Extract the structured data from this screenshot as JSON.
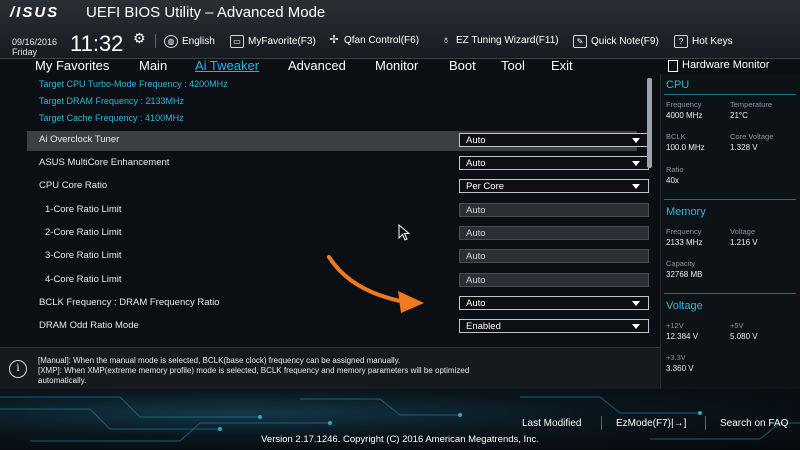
{
  "header": {
    "brand": "/ISUS",
    "title": "UEFI BIOS Utility – Advanced Mode",
    "date": "09/16/2016",
    "day": "Friday",
    "time": "11:32",
    "tools": [
      {
        "label": "English",
        "icon": "globe-icon"
      },
      {
        "label": "MyFavorite(F3)",
        "icon": "favorite-icon"
      },
      {
        "label": "Qfan Control(F6)",
        "icon": "fan-icon"
      },
      {
        "label": "EZ Tuning Wizard(F11)",
        "icon": "bulb-icon"
      },
      {
        "label": "Quick Note(F9)",
        "icon": "note-icon"
      },
      {
        "label": "Hot Keys",
        "icon": "help-icon"
      }
    ]
  },
  "menu": {
    "items": [
      "My Favorites",
      "Main",
      "Ai Tweaker",
      "Advanced",
      "Monitor",
      "Boot",
      "Tool",
      "Exit"
    ],
    "active": "Ai Tweaker"
  },
  "info": [
    "Target CPU Turbo-Mode Frequency : 4200MHz",
    "Target DRAM Frequency : 2133MHz",
    "Target Cache Frequency : 4100MHz"
  ],
  "settings": [
    {
      "label": "Ai Overclock Tuner",
      "value": "Auto",
      "type": "dropdown",
      "selected": true
    },
    {
      "label": "ASUS MultiCore Enhancement",
      "value": "Auto",
      "type": "dropdown"
    },
    {
      "label": "CPU Core Ratio",
      "value": "Per Core",
      "type": "dropdown"
    },
    {
      "label": "1-Core Ratio Limit",
      "value": "Auto",
      "type": "textbox",
      "sub": true
    },
    {
      "label": "2-Core Ratio Limit",
      "value": "Auto",
      "type": "textbox",
      "sub": true
    },
    {
      "label": "3-Core Ratio Limit",
      "value": "Auto",
      "type": "textbox",
      "sub": true
    },
    {
      "label": "4-Core Ratio Limit",
      "value": "Auto",
      "type": "textbox",
      "sub": true
    },
    {
      "label": "BCLK Frequency : DRAM Frequency Ratio",
      "value": "Auto",
      "type": "dropdown"
    },
    {
      "label": "DRAM Odd Ratio Mode",
      "value": "Enabled",
      "type": "dropdown"
    }
  ],
  "help": {
    "lines": [
      "[Manual]: When the manual mode is selected, BCLK(base clock) frequency can be assigned manually.",
      "[XMP]: When XMP(extreme memory profile) mode is selected, BCLK frequency and memory parameters will be optimized",
      "automatically."
    ]
  },
  "hardware_monitor": {
    "title": "Hardware Monitor",
    "cpu": {
      "heading": "CPU",
      "frequency_label": "Frequency",
      "frequency": "4000 MHz",
      "temperature_label": "Temperature",
      "temperature": "21°C",
      "bclk_label": "BCLK",
      "bclk": "100.0 MHz",
      "core_voltage_label": "Core Voltage",
      "core_voltage": "1.328 V",
      "ratio_label": "Ratio",
      "ratio": "40x"
    },
    "memory": {
      "heading": "Memory",
      "frequency_label": "Frequency",
      "frequency": "2133 MHz",
      "voltage_label": "Voltage",
      "voltage": "1.216 V",
      "capacity_label": "Capacity",
      "capacity": "32768 MB"
    },
    "voltage": {
      "heading": "Voltage",
      "v12_label": "+12V",
      "v12": "12.384 V",
      "v5_label": "+5V",
      "v5": "5.080 V",
      "v33_label": "+3.3V",
      "v33": "3.360 V"
    }
  },
  "footer": {
    "last_modified": "Last Modified",
    "ezmode": "EzMode(F7)|→]",
    "search": "Search on FAQ",
    "version": "Version 2.17.1246. Copyright (C) 2016 American Megatrends, Inc."
  },
  "colors": {
    "accent": "#2fb7d9",
    "annotation_arrow": "#f07a1f"
  }
}
